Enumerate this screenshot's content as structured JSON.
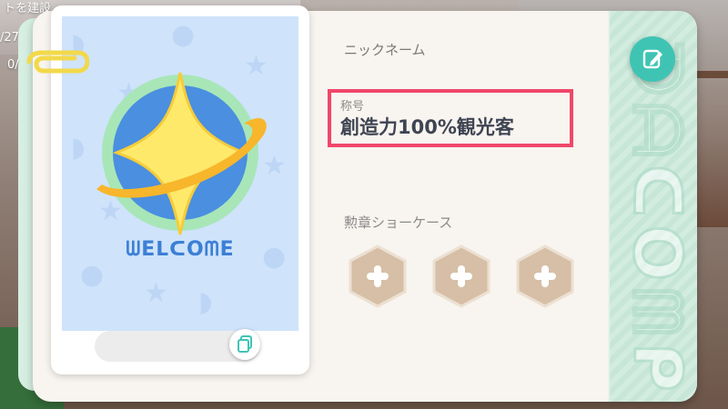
{
  "background": {
    "top_left_text": "トを建設",
    "left_counter_top": "/27",
    "left_counter_bottom": "0/"
  },
  "photo": {
    "welcome_text": "ᗯEᒪᑕOᗰE"
  },
  "profile": {
    "nickname_label": "ニックネーム",
    "title_label": "称号",
    "title_value": "創造力100%観光客",
    "badge_showcase_label": "勲章ショーケース"
  },
  "side_strip": {
    "vertical_text": "ᗪᗩᑕOᗰᑭ"
  },
  "colors": {
    "accent_teal": "#3fc4b4",
    "highlight_red": "#f0476a",
    "badge_slot": "#d6bfa6",
    "star_yellow": "#ffe96b",
    "globe_blue": "#4a8fe0"
  },
  "icons": {
    "edit": "edit-pencil-icon",
    "copy": "copy-icon",
    "badge_add": "plus-icon",
    "paperclip": "paperclip-icon"
  }
}
